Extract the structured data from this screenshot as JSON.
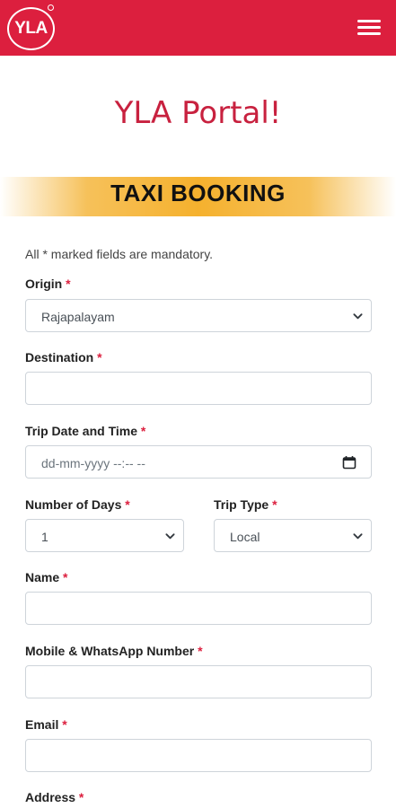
{
  "header": {
    "logo_text": "YLA",
    "brand_color": "#dc1f3e"
  },
  "portal_title": "YLA Portal!",
  "section_title": "TAXI BOOKING",
  "mandatory_note": "All * marked fields are mandatory.",
  "required_mark": "*",
  "form": {
    "origin": {
      "label": "Origin",
      "value": "Rajapalayam"
    },
    "destination": {
      "label": "Destination",
      "value": ""
    },
    "trip_datetime": {
      "label": "Trip Date and Time",
      "placeholder": "dd-mm-yyyy --:-- --"
    },
    "number_of_days": {
      "label": "Number of Days",
      "value": "1"
    },
    "trip_type": {
      "label": "Trip Type",
      "value": "Local"
    },
    "name": {
      "label": "Name",
      "value": ""
    },
    "mobile": {
      "label": "Mobile & WhatsApp Number",
      "value": ""
    },
    "email": {
      "label": "Email",
      "value": ""
    },
    "address": {
      "label": "Address"
    }
  },
  "icons": {
    "menu": "hamburger-menu-icon",
    "select": "chevron-down-icon",
    "calendar": "calendar-icon"
  }
}
